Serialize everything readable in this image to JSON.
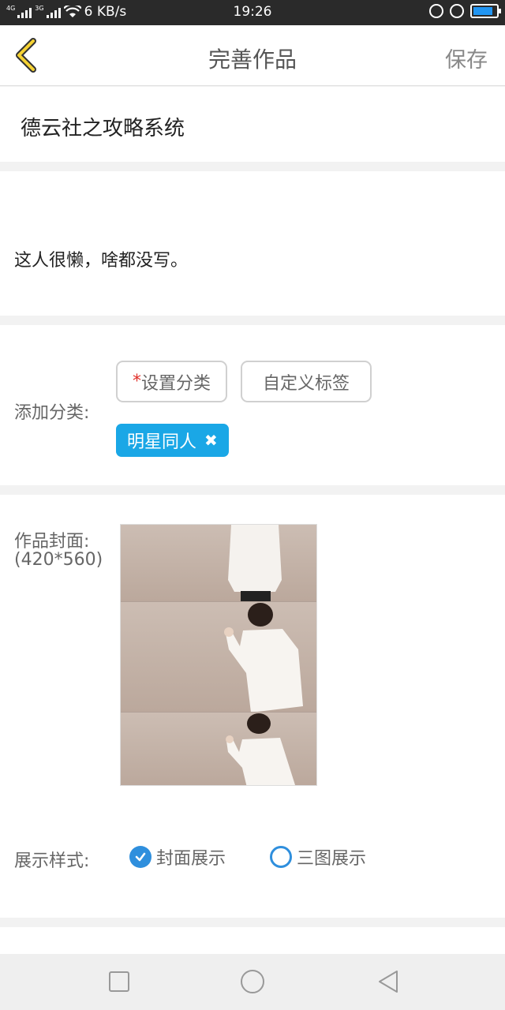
{
  "status_bar": {
    "net_speed": "6 KB/s",
    "time": "19:26",
    "sim1": "4G",
    "sim2": "3G"
  },
  "header": {
    "title": "完善作品",
    "save_label": "保存",
    "back_icon": "chevron-left-icon"
  },
  "work": {
    "title": "德云社之攻略系统",
    "description": "这人很懒，啥都没写。"
  },
  "category": {
    "label": "添加分类:",
    "required_mark": "*",
    "set_category_label": "设置分类",
    "custom_tag_label": "自定义标签",
    "selected_tags": [
      {
        "label": "明星同人",
        "remove_icon": "close-icon"
      }
    ]
  },
  "cover": {
    "label": "作品封面:",
    "size_hint": "(420*560)"
  },
  "display_style": {
    "label": "展示样式:",
    "options": [
      {
        "label": "封面展示",
        "selected": true
      },
      {
        "label": "三图展示",
        "selected": false
      }
    ]
  },
  "colors": {
    "accent_blue": "#2f8fdd",
    "chip_blue": "#1aa7e6",
    "back_yellow": "#f5d233",
    "required_red": "#e0302a"
  }
}
